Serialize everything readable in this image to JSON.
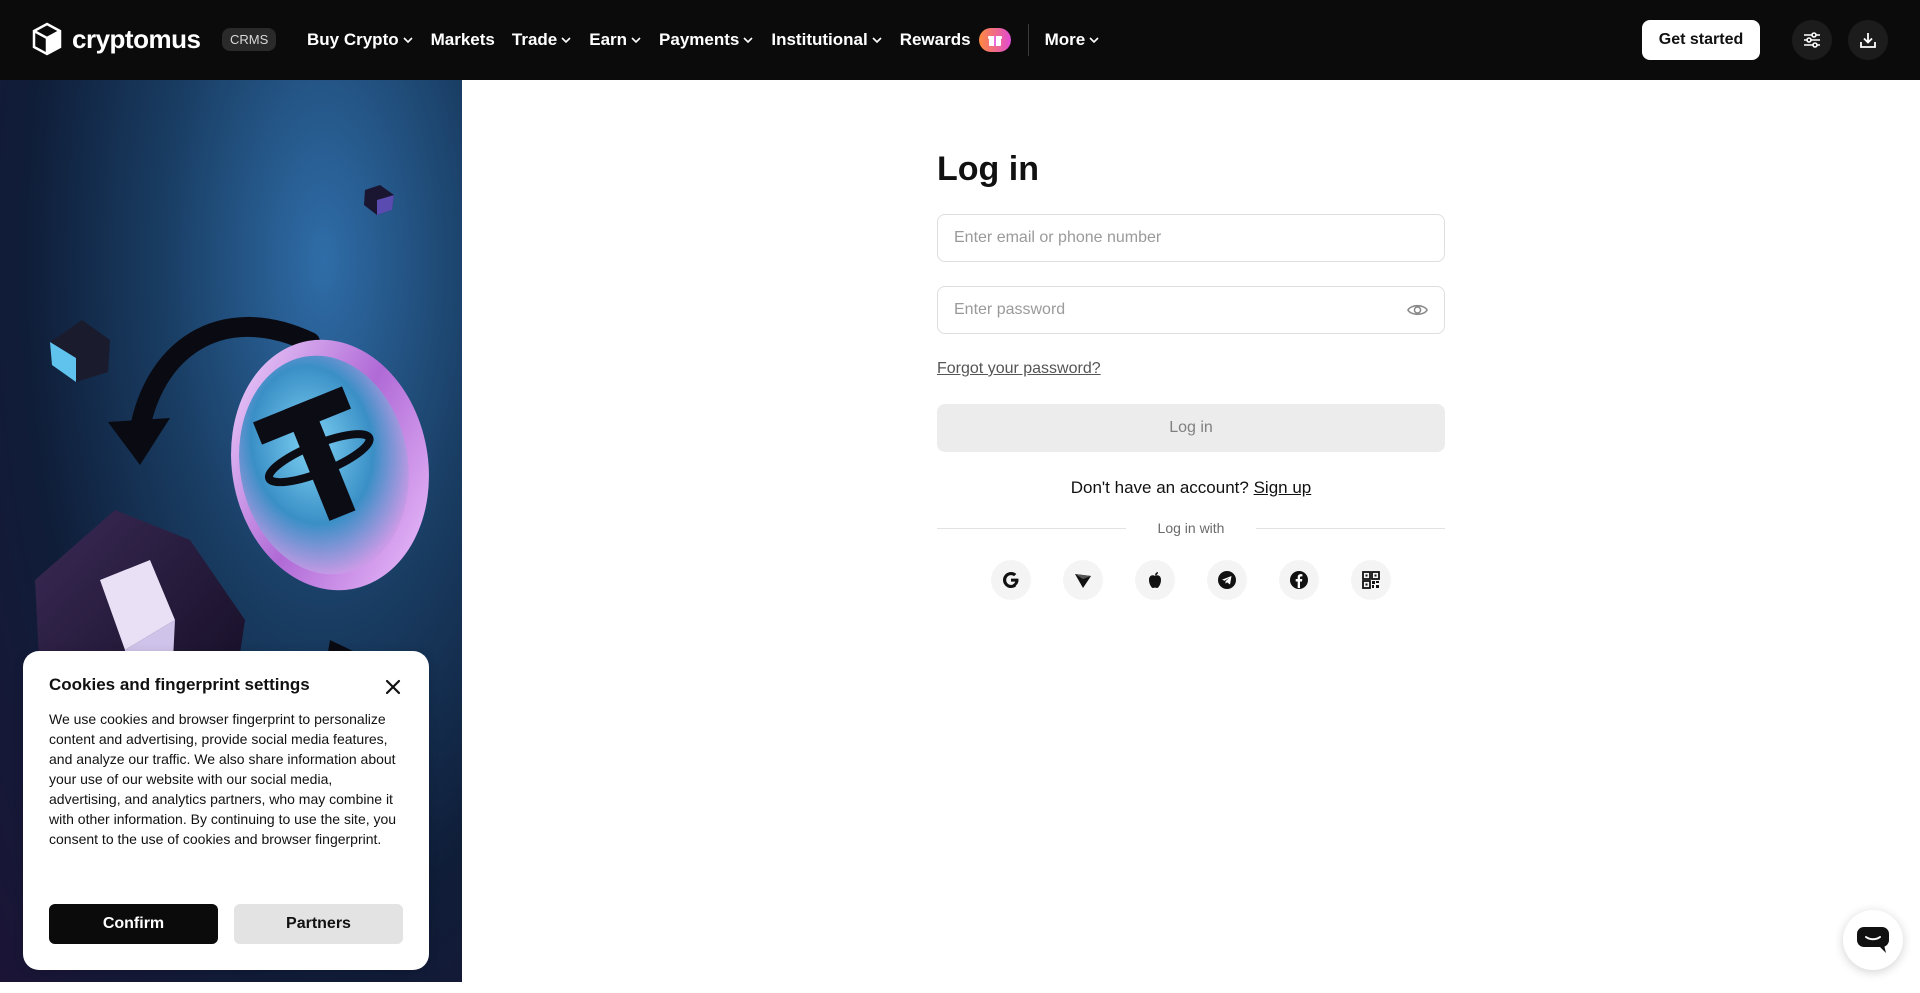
{
  "header": {
    "logo_text": "cryptomus",
    "badge": "CRMS",
    "nav": [
      {
        "label": "Buy Crypto",
        "dropdown": true
      },
      {
        "label": "Markets",
        "dropdown": false
      },
      {
        "label": "Trade",
        "dropdown": true
      },
      {
        "label": "Earn",
        "dropdown": true
      },
      {
        "label": "Payments",
        "dropdown": true
      },
      {
        "label": "Institutional",
        "dropdown": true
      },
      {
        "label": "Rewards",
        "dropdown": false,
        "icon": "gift-icon"
      },
      {
        "label": "More",
        "dropdown": true
      }
    ],
    "get_started": "Get started",
    "icons": [
      "settings-sliders-icon",
      "download-icon"
    ]
  },
  "login": {
    "title": "Log in",
    "email_placeholder": "Enter email or phone number",
    "password_placeholder": "Enter password",
    "forgot": "Forgot your password?",
    "submit": "Log in",
    "no_account": "Don't have an account?",
    "sign_up": "Sign up",
    "login_with": "Log in with",
    "socials": [
      "google-icon",
      "tron-icon",
      "apple-icon",
      "telegram-icon",
      "facebook-icon",
      "qr-code-icon"
    ]
  },
  "cookie": {
    "title": "Cookies and fingerprint settings",
    "text": "We use cookies and browser fingerprint to personalize content and advertising, provide social media features, and analyze our traffic. We also share information about your use of our website with our social media, advertising, and analytics partners, who may combine it with other information. By continuing to use the site, you consent to the use of cookies and browser fingerprint.",
    "confirm": "Confirm",
    "partners": "Partners"
  },
  "colors": {
    "header_bg": "#0b0b0b",
    "accent_gift": "#e14bd3",
    "button_disabled": "#ececec"
  }
}
